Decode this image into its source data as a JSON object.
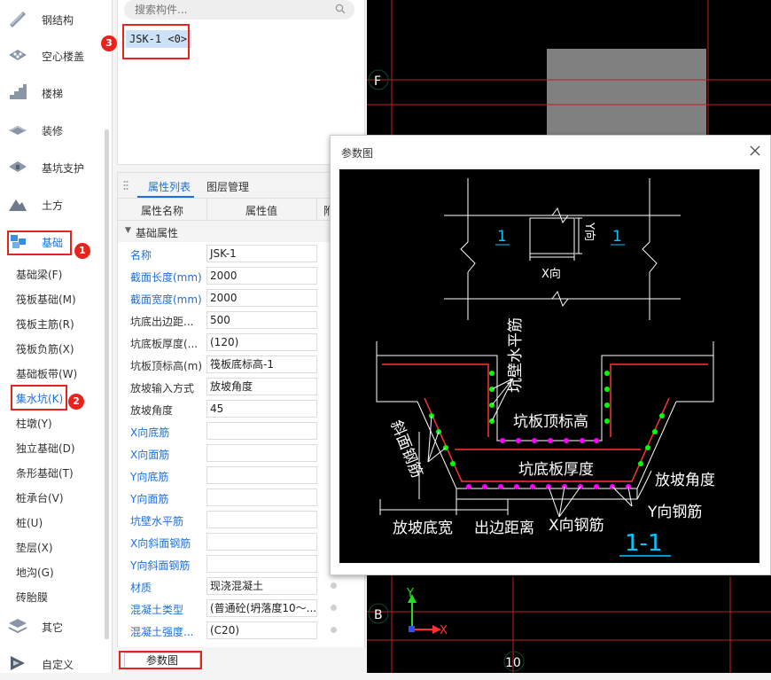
{
  "sidebar": {
    "categories": [
      {
        "label": "钢结构",
        "icon": "steel-structure-icon"
      },
      {
        "label": "空心楼盖",
        "icon": "hollow-floor-icon"
      },
      {
        "label": "楼梯",
        "icon": "stairs-icon"
      },
      {
        "label": "装修",
        "icon": "decoration-icon"
      },
      {
        "label": "基坑支护",
        "icon": "pit-support-icon"
      },
      {
        "label": "土方",
        "icon": "earthwork-icon"
      },
      {
        "label": "基础",
        "icon": "foundation-icon"
      }
    ],
    "sub_items": [
      "基础梁(F)",
      "筏板基础(M)",
      "筏板主筋(R)",
      "筏板负筋(X)",
      "基础板带(W)",
      "集水坑(K)",
      "柱墩(Y)",
      "独立基础(D)",
      "条形基础(T)",
      "桩承台(V)",
      "桩(U)",
      "垫层(X)",
      "地沟(G)",
      "砖胎膜"
    ],
    "bottom_categories": [
      {
        "label": "其它",
        "icon": "other-icon"
      },
      {
        "label": "自定义",
        "icon": "custom-icon"
      }
    ],
    "badges": [
      "1",
      "2"
    ]
  },
  "search": {
    "placeholder": "搜索构件..."
  },
  "component_list": {
    "item": "JSK-1 <0>",
    "badge": "3"
  },
  "property_panel": {
    "tabs": [
      "属性列表",
      "图层管理"
    ],
    "columns": [
      "属性名称",
      "属性值",
      "附"
    ],
    "group": "基础属性",
    "rows": [
      {
        "name": "名称",
        "value": "JSK-1",
        "blue": true
      },
      {
        "name": "截面长度(mm)",
        "value": "2000",
        "blue": true
      },
      {
        "name": "截面宽度(mm)",
        "value": "2000",
        "blue": true
      },
      {
        "name": "坑底出边距...",
        "value": "500",
        "blue": false
      },
      {
        "name": "坑底板厚度(...",
        "value": "(120)",
        "blue": false
      },
      {
        "name": "坑板顶标高(m)",
        "value": "筏板底标高-1",
        "blue": false
      },
      {
        "name": "放坡输入方式",
        "value": "放坡角度",
        "blue": false
      },
      {
        "name": "放坡角度",
        "value": "45",
        "blue": false
      },
      {
        "name": "X向底筋",
        "value": "",
        "blue": true
      },
      {
        "name": "X向面筋",
        "value": "",
        "blue": true
      },
      {
        "name": "Y向底筋",
        "value": "",
        "blue": true
      },
      {
        "name": "Y向面筋",
        "value": "",
        "blue": true
      },
      {
        "name": "坑壁水平筋",
        "value": "",
        "blue": true
      },
      {
        "name": "X向斜面钢筋",
        "value": "",
        "blue": true
      },
      {
        "name": "Y向斜面钢筋",
        "value": "",
        "blue": true
      },
      {
        "name": "材质",
        "value": "现浇混凝土",
        "blue": true
      },
      {
        "name": "混凝土类型",
        "value": "(普通砼(坍落度10～...",
        "blue": true
      },
      {
        "name": "混凝土强度...",
        "value": "(C20)",
        "blue": true
      }
    ]
  },
  "bottom_button": "参数图",
  "canvas": {
    "axis_labels": [
      "F",
      "B",
      "10"
    ],
    "axis_x": "X",
    "axis_y": "Y"
  },
  "dialog": {
    "title": "参数图",
    "drawing": {
      "section_mark": "1",
      "x_dir": "X向",
      "y_dir": "Y向",
      "labels": {
        "wall_horizontal": "坑壁水平筋",
        "top_elevation": "坑板顶标高",
        "slope_bar": "斜面钢筋",
        "bottom_thickness": "坑底板厚度",
        "slope_angle": "放坡角度",
        "slope_width": "放坡底宽",
        "edge_distance": "出边距离",
        "x_bar": "X向钢筋",
        "y_bar": "Y向钢筋",
        "section_title": "1-1"
      }
    }
  },
  "colors": {
    "accent": "#1e6fd9",
    "highlight": "#e8231d",
    "rebar_green": "#00ff00",
    "rebar_magenta": "#ff00ff",
    "cad_red": "#ff3333",
    "cad_cyan": "#00c8ff"
  }
}
